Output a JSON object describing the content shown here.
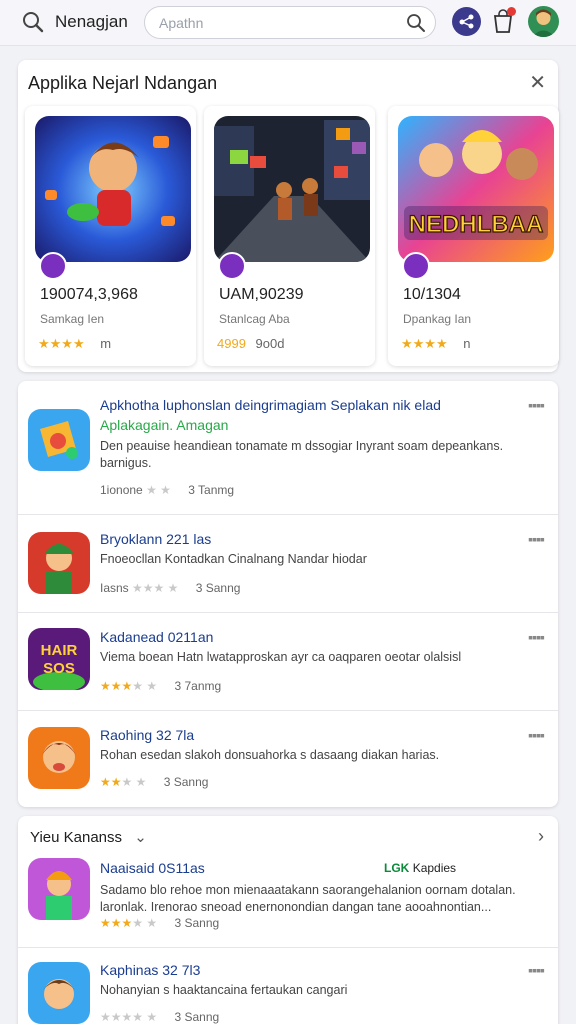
{
  "topbar": {
    "title": "Nenagjan",
    "search_placeholder": "Apathn",
    "icons": [
      "search-icon",
      "share-icon",
      "cart-icon",
      "avatar"
    ],
    "colors": {
      "share_bg": "#3b3a8c",
      "notification_dot": "#e53935"
    }
  },
  "featured": {
    "title": "Applika Nejarl Ndangan",
    "cards": [
      {
        "stat": "190074,3,968",
        "sub": "Samkag Ien",
        "stars": 4,
        "rating_text": "m"
      },
      {
        "stat": "UAM,90239",
        "sub": "Stanlcag Aba",
        "stars": 0,
        "rating_text": "9o0d",
        "coin_row": "4999"
      },
      {
        "stat": "10/1304",
        "sub": "Dpankag Ian",
        "stars": 4,
        "rating_text": "n",
        "art_text": "NEDHLBAA"
      }
    ]
  },
  "list": {
    "items": [
      {
        "title": "Apkhotha luphonslan deingrimagiam Seplakan nik elad",
        "title2": "Aplakagain. Amagan",
        "desc": "Den peauise heandiean tonamate m dssogiar Inyrant soam depeankans. barnigus.",
        "meta": "1ionone",
        "stars": 1,
        "count": "3 Tanmg"
      },
      {
        "title": "Bryoklann 221 las",
        "desc": "Fnoeocllan Kontadkan Cinalnang Nandar hiodar",
        "meta": "Iasns",
        "stars": 0,
        "count": "3 Sanng"
      },
      {
        "title": "Kadanead 0211an",
        "desc": "Viema boean Hatn lwatapproskan ayr ca oaqparen oeotar olalsisl",
        "meta": "",
        "stars": 3,
        "count": "3 7anmg",
        "icon_text": "HAIR SOS"
      },
      {
        "title": "Raohing 32 7la",
        "desc": "Rohan esedan slakoh donsuahorka s dasaang diakan harias.",
        "meta": "",
        "stars": 2,
        "count": "3 Sanng"
      }
    ]
  },
  "section": {
    "title": "Yieu Kananss",
    "tag_prefix": "LGK",
    "tag_text": "Kapdies",
    "items": [
      {
        "title": "Naaisaid 0S11as",
        "desc": "Sadamo blo rehoe mon mienaaatakann saorangehalanion oornam dotalan. laronlak. Irenorao sneoad enernonondian dangan tane aooahnontian...",
        "stars": 3,
        "count": "3 Sanng"
      },
      {
        "title": "Kaphinas 32 7l3",
        "desc": "Nohanyian s haaktancaina fertaukan cangari",
        "stars": 0,
        "count": "3 Sanng"
      }
    ]
  }
}
